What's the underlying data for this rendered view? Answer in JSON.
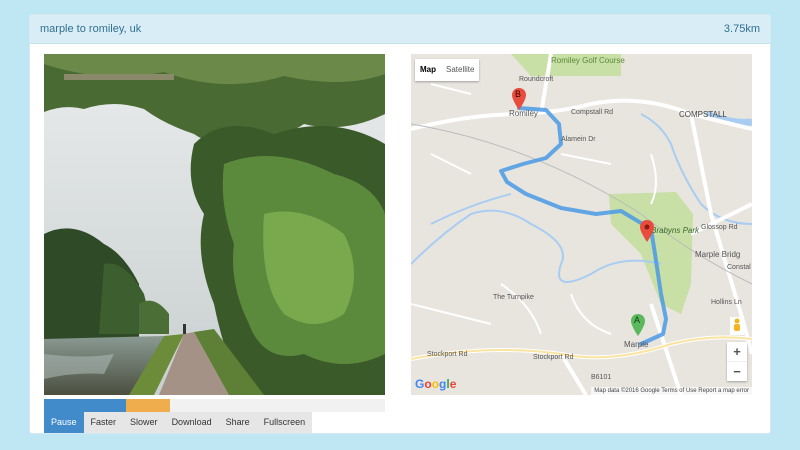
{
  "header": {
    "title": "marple to romiley, uk",
    "distance": "3.75km"
  },
  "progress": {
    "played_fraction": 0.24,
    "buffered_fraction": 0.37,
    "played_color": "#428bca",
    "buffered_color": "#f0ad4e"
  },
  "controls": [
    {
      "label": "Pause",
      "active": true
    },
    {
      "label": "Faster"
    },
    {
      "label": "Slower"
    },
    {
      "label": "Download"
    },
    {
      "label": "Share"
    },
    {
      "label": "Fullscreen"
    }
  ],
  "map": {
    "type_controls": [
      "Map",
      "Satellite"
    ],
    "selected_type": "Map",
    "labels": {
      "golf": "Romiley Golf Course",
      "compstall": "COMPSTALL",
      "romiley": "Romiley",
      "compstall_rd": "Compstall Rd",
      "park": "Brabyns Park",
      "marple_bridge": "Marple Bridg",
      "constable": "Constal",
      "marple": "Marple",
      "stockport_rd_1": "Stockport Rd",
      "stockport_rd_2": "Stockport Rd",
      "the_turnpike": "The Turnpike",
      "hollins_ln": "Hollins Ln",
      "glossop_rd": "Glossop Rd",
      "b6101": "B6101",
      "roundcroft": "Roundcroft",
      "alamein_dr": "Alamein Dr"
    },
    "markers": {
      "start": "A",
      "end": "B"
    },
    "zoom_in": "+",
    "zoom_out": "−",
    "logo": "Google",
    "attribution": "Map data ©2016 Google   Terms of Use   Report a map error",
    "route_color": "#4a9ae6"
  },
  "icons": {
    "pegman": "pegman-icon",
    "marker": "map-pin-icon"
  }
}
